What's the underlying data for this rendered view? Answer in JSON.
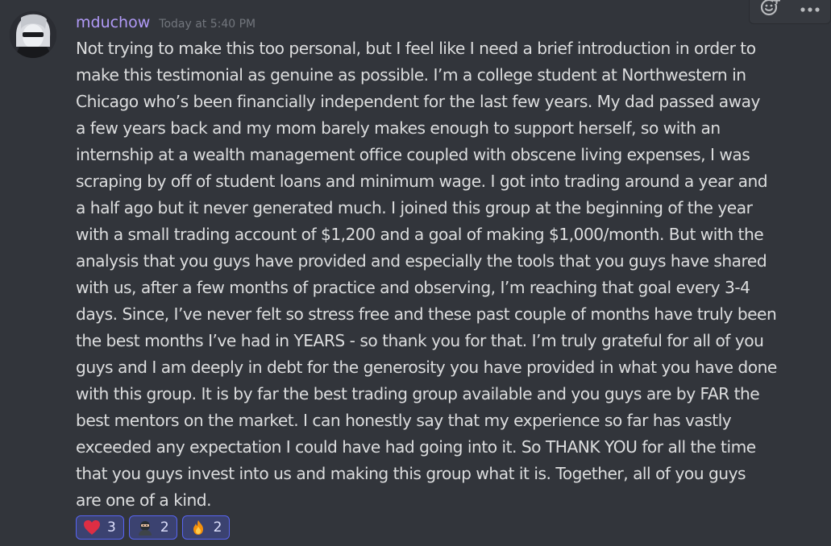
{
  "message": {
    "author": "mduchow",
    "timestamp": "Today at 5:40 PM",
    "lines": [
      "Not trying to make this too personal, but I feel like I need a brief introduction in order to",
      "make this testimonial as genuine as possible. I’m a college student at Northwestern in",
      "Chicago who’s been financially independent for the last few years. My dad passed away",
      "a few years back and my mom barely makes enough to support herself, so with an",
      "internship at a wealth management office coupled with obscene living expenses, I was",
      "scraping by off of student loans and minimum wage. I got into trading around a year and",
      "a half ago but it never generated much. I joined this group at the beginning of the year",
      "with a small trading account of $1,200 and a goal of making $1,000/month. But with the",
      "analysis that you guys have provided and especially the tools that you guys have shared",
      "with us, after a few months of practice and observing, I’m reaching that goal every 3-4",
      "days. Since, I’ve never felt so stress free and these past couple of months have truly been",
      "the best months I’ve had in YEARS - so thank you for that. I’m truly grateful for all of you",
      "guys and I am deeply in debt for the generosity you have provided in what you have done",
      "with this group. It is by far the best trading group available and you guys are by FAR the",
      "best mentors on the market. I can honestly say that my experience so far has vastly",
      "exceeded any expectation I could have had going into it. So THANK YOU for all the time",
      "that you guys invest into us and making this group what it is. Together, all of you guys",
      "are one of a kind."
    ]
  },
  "reactions": [
    {
      "emoji": "heart-icon",
      "count": "3"
    },
    {
      "emoji": "ninja-icon",
      "count": "2"
    },
    {
      "emoji": "fire-icon",
      "count": "2"
    }
  ],
  "toolbar": {
    "icons": [
      "add-reaction-icon",
      "more-options-icon"
    ]
  },
  "colors": {
    "background": "#32353b",
    "username": "#b19af7",
    "text": "#dcddde",
    "timestamp": "#72767d",
    "reaction_bg": "#3b4270",
    "reaction_border": "#5865f2"
  }
}
